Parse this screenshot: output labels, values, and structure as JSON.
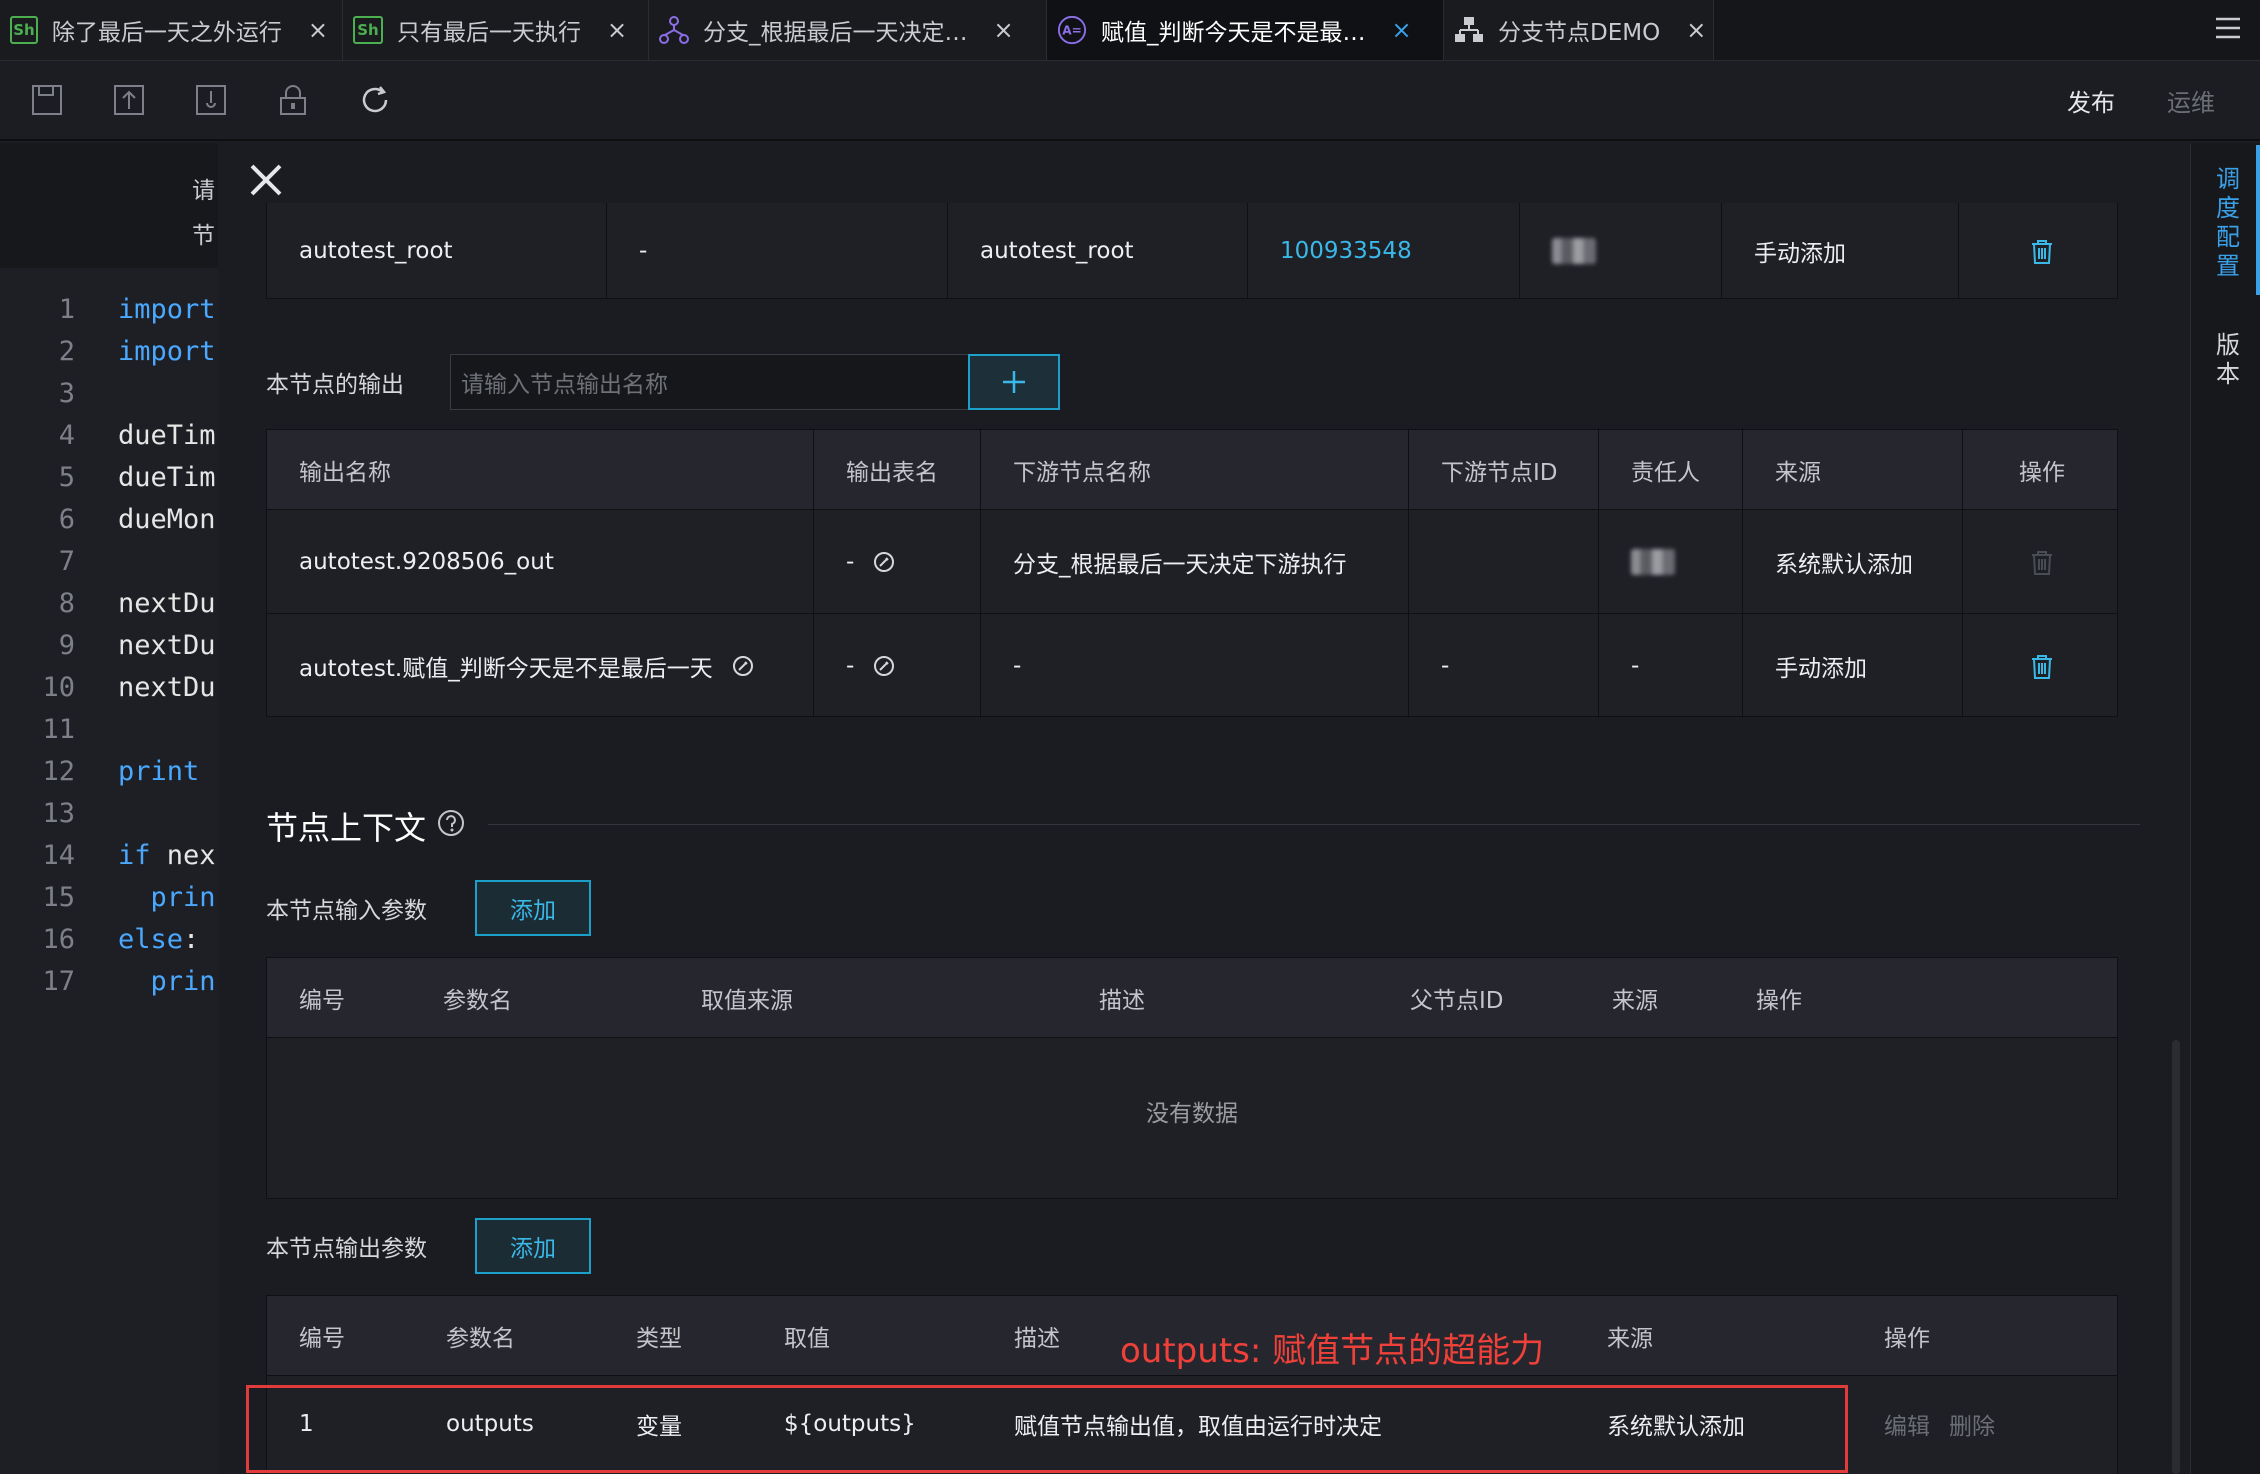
{
  "tabs": [
    {
      "icon": "sh-script-icon",
      "icon_text": "Sh",
      "label": "除了最后一天之外运行",
      "active": false
    },
    {
      "icon": "sh-script-icon",
      "icon_text": "Sh",
      "label": "只有最后一天执行",
      "active": false
    },
    {
      "icon": "branch-node-icon",
      "icon_text": "",
      "label": "分支_根据最后一天决定…",
      "active": false
    },
    {
      "icon": "assignment-node-icon",
      "icon_text": "A=",
      "label": "赋值_判断今天是不是最…",
      "active": true
    },
    {
      "icon": "branch-demo-icon",
      "icon_text": "",
      "label": "分支节点DEMO",
      "active": false
    }
  ],
  "toolbar": {
    "publish": "发布",
    "ops": "运维"
  },
  "editor": {
    "header_lines": [
      "请",
      "节"
    ],
    "lines": [
      {
        "n": "1",
        "code": "import",
        "kw": true
      },
      {
        "n": "2",
        "code": "import",
        "kw": true
      },
      {
        "n": "3",
        "code": "",
        "kw": false
      },
      {
        "n": "4",
        "code": "dueTim",
        "kw": false
      },
      {
        "n": "5",
        "code": "dueTim",
        "kw": false
      },
      {
        "n": "6",
        "code": "dueMon",
        "kw": false
      },
      {
        "n": "7",
        "code": "",
        "kw": false
      },
      {
        "n": "8",
        "code": "nextDu",
        "kw": false
      },
      {
        "n": "9",
        "code": "nextDu",
        "kw": false
      },
      {
        "n": "10",
        "code": "nextDu",
        "kw": false
      },
      {
        "n": "11",
        "code": "",
        "kw": false
      },
      {
        "n": "12",
        "code": "print",
        "kw": true
      },
      {
        "n": "13",
        "code": "",
        "kw": false
      },
      {
        "n": "14",
        "code": "if nex",
        "kw": "if"
      },
      {
        "n": "15",
        "code": "  prin",
        "kw": true
      },
      {
        "n": "16",
        "code": "else:",
        "kw": "else"
      },
      {
        "n": "17",
        "code": "  prin",
        "kw": true
      }
    ]
  },
  "input_table_row": {
    "name": "autotest_root",
    "table": "-",
    "upstream_name": "autotest_root",
    "upstream_id": "100933548",
    "source": "手动添加"
  },
  "outputs_section": {
    "label": "本节点的输出",
    "placeholder": "请输入节点输出名称",
    "headers": [
      "输出名称",
      "输出表名",
      "下游节点名称",
      "下游节点ID",
      "责任人",
      "来源",
      "操作"
    ],
    "rows": [
      {
        "name": "autotest.9208506_out",
        "table": "-",
        "downstream": "分支_根据最后一天决定下游执行",
        "downstream_id": "",
        "owner": "",
        "source": "系统默认添加"
      },
      {
        "name": "autotest.赋值_判断今天是不是最后一天",
        "table": "-",
        "downstream": "-",
        "downstream_id": "-",
        "owner": "-",
        "source": "手动添加"
      }
    ]
  },
  "context": {
    "title": "节点上下文",
    "input_params_label": "本节点输入参数",
    "add_label": "添加",
    "input_headers": [
      "编号",
      "参数名",
      "取值来源",
      "描述",
      "父节点ID",
      "来源",
      "操作"
    ],
    "empty_text": "没有数据",
    "output_params_label": "本节点输出参数",
    "output_headers": [
      "编号",
      "参数名",
      "类型",
      "取值",
      "描述",
      "来源",
      "操作"
    ],
    "output_rows": [
      {
        "no": "1",
        "name": "outputs",
        "type": "变量",
        "value": "${outputs}",
        "desc": "赋值节点输出值，取值由运行时决定",
        "source": "系统默认添加",
        "edit": "编辑",
        "delete": "删除"
      }
    ]
  },
  "annotation": "outputs: 赋值节点的超能力",
  "sidebar": {
    "schedule": "调度配置",
    "version": "版本"
  },
  "colors": {
    "accent": "#3aa0e8",
    "cyan": "#3ab8e8",
    "annotation": "#f0403a"
  }
}
